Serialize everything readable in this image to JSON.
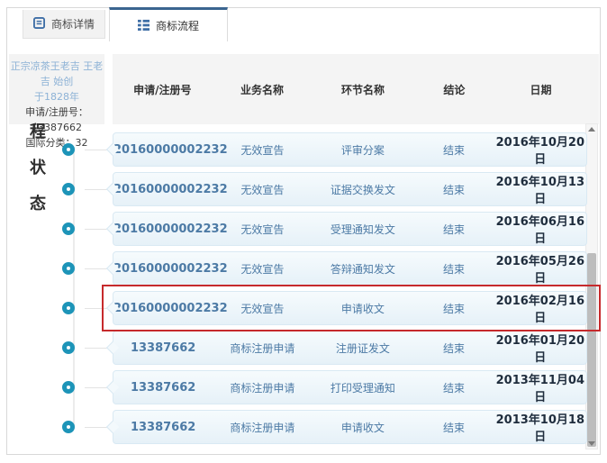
{
  "tabs": [
    {
      "label": "商标详情",
      "icon": "document-icon",
      "active": false
    },
    {
      "label": "商标流程",
      "icon": "list-icon",
      "active": true
    }
  ],
  "trademark_info": {
    "name_line1": "正宗凉茶王老吉 王老吉 始创",
    "name_line2": "于1828年",
    "registration_no": "申请/注册号：13387662",
    "intl_class": "国际分类：32"
  },
  "process_status_label": {
    "char1": "程",
    "char2": "状",
    "char3": "态"
  },
  "table": {
    "headers": [
      "申请/注册号",
      "业务名称",
      "环节名称",
      "结论",
      "日期"
    ],
    "rows": [
      {
        "reg_no": "20160000002232",
        "business": "无效宣告",
        "step": "评审分案",
        "conclusion": "结束",
        "date": "2016年10月20日",
        "highlighted": false
      },
      {
        "reg_no": "20160000002232",
        "business": "无效宣告",
        "step": "证据交换发文",
        "conclusion": "结束",
        "date": "2016年10月13日",
        "highlighted": false
      },
      {
        "reg_no": "20160000002232",
        "business": "无效宣告",
        "step": "受理通知发文",
        "conclusion": "结束",
        "date": "2016年06月16日",
        "highlighted": false
      },
      {
        "reg_no": "20160000002232",
        "business": "无效宣告",
        "step": "答辩通知发文",
        "conclusion": "结束",
        "date": "2016年05月26日",
        "highlighted": false
      },
      {
        "reg_no": "20160000002232",
        "business": "无效宣告",
        "step": "申请收文",
        "conclusion": "结束",
        "date": "2016年02月16日",
        "highlighted": true
      },
      {
        "reg_no": "13387662",
        "business": "商标注册申请",
        "step": "注册证发文",
        "conclusion": "结束",
        "date": "2016年01月20日",
        "highlighted": false
      },
      {
        "reg_no": "13387662",
        "business": "商标注册申请",
        "step": "打印受理通知",
        "conclusion": "结束",
        "date": "2013年11月04日",
        "highlighted": false
      },
      {
        "reg_no": "13387662",
        "business": "商标注册申请",
        "step": "申请收文",
        "conclusion": "结束",
        "date": "2013年10月18日",
        "highlighted": false
      }
    ]
  },
  "icons": {
    "tab_document": "document-icon",
    "tab_list": "list-icon",
    "scroll_up": "triangle-up",
    "scroll_down": "triangle-down",
    "timeline_dot": "circle-ring"
  },
  "colors": {
    "accent_teal": "#1d94b8",
    "tab_active_border": "#3b6590",
    "link_blue": "#4c7aa5",
    "date_text": "#1f2d3d",
    "highlight_red": "#c62a2c",
    "icon_blue": "#3e6ea6",
    "bubble_bg": "#e9f3fa",
    "header_bg": "#f4f4f4"
  }
}
